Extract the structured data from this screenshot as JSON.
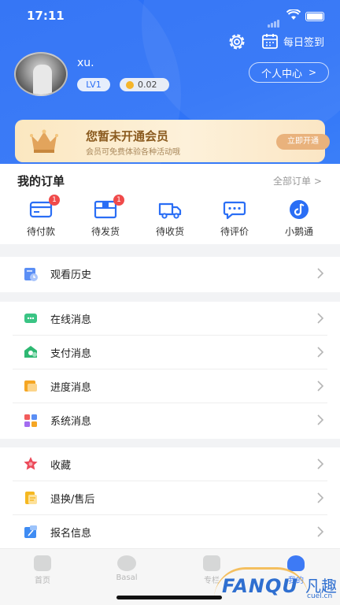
{
  "status": {
    "time": "17:11"
  },
  "header": {
    "checkin_label": "每日签到",
    "username": "xu.",
    "level": "LV1",
    "coins": "0.02",
    "profile_label": "个人中心"
  },
  "vip": {
    "title": "您暂未开通会员",
    "subtitle": "会员可免费体验各种活动哦",
    "button": "立即开通"
  },
  "orders": {
    "title": "我的订单",
    "all_label": "全部订单",
    "items": [
      {
        "label": "待付款",
        "icon": "wallet-icon",
        "badge": "1"
      },
      {
        "label": "待发货",
        "icon": "package-icon",
        "badge": "1"
      },
      {
        "label": "待收货",
        "icon": "truck-icon",
        "badge": ""
      },
      {
        "label": "待评价",
        "icon": "chat-icon",
        "badge": ""
      },
      {
        "label": "小鹅通",
        "icon": "goose-icon",
        "badge": ""
      }
    ]
  },
  "menu_groups": [
    [
      {
        "label": "观看历史",
        "icon": "history-icon"
      }
    ],
    [
      {
        "label": "在线消息",
        "icon": "online-message-icon"
      },
      {
        "label": "支付消息",
        "icon": "payment-message-icon"
      },
      {
        "label": "进度消息",
        "icon": "progress-message-icon"
      },
      {
        "label": "系统消息",
        "icon": "system-message-icon"
      }
    ],
    [
      {
        "label": "收藏",
        "icon": "favorite-icon"
      },
      {
        "label": "退换/售后",
        "icon": "return-icon"
      },
      {
        "label": "报名信息",
        "icon": "signup-info-icon"
      }
    ]
  ],
  "tabbar": {
    "tabs": [
      {
        "label": "首页",
        "icon": "home-icon"
      },
      {
        "label": "Basal",
        "icon": "basal-icon"
      },
      {
        "label": "专栏",
        "icon": "column-icon"
      },
      {
        "label": "我的",
        "icon": "profile-icon"
      }
    ]
  },
  "watermark": {
    "brand": "FANQU",
    "cn": "凡趣",
    "domain": "cuel.cn"
  },
  "colors": {
    "primary": "#2a6ef5",
    "vip_gold": "#8a5a1e",
    "badge_red": "#f04a4a"
  }
}
